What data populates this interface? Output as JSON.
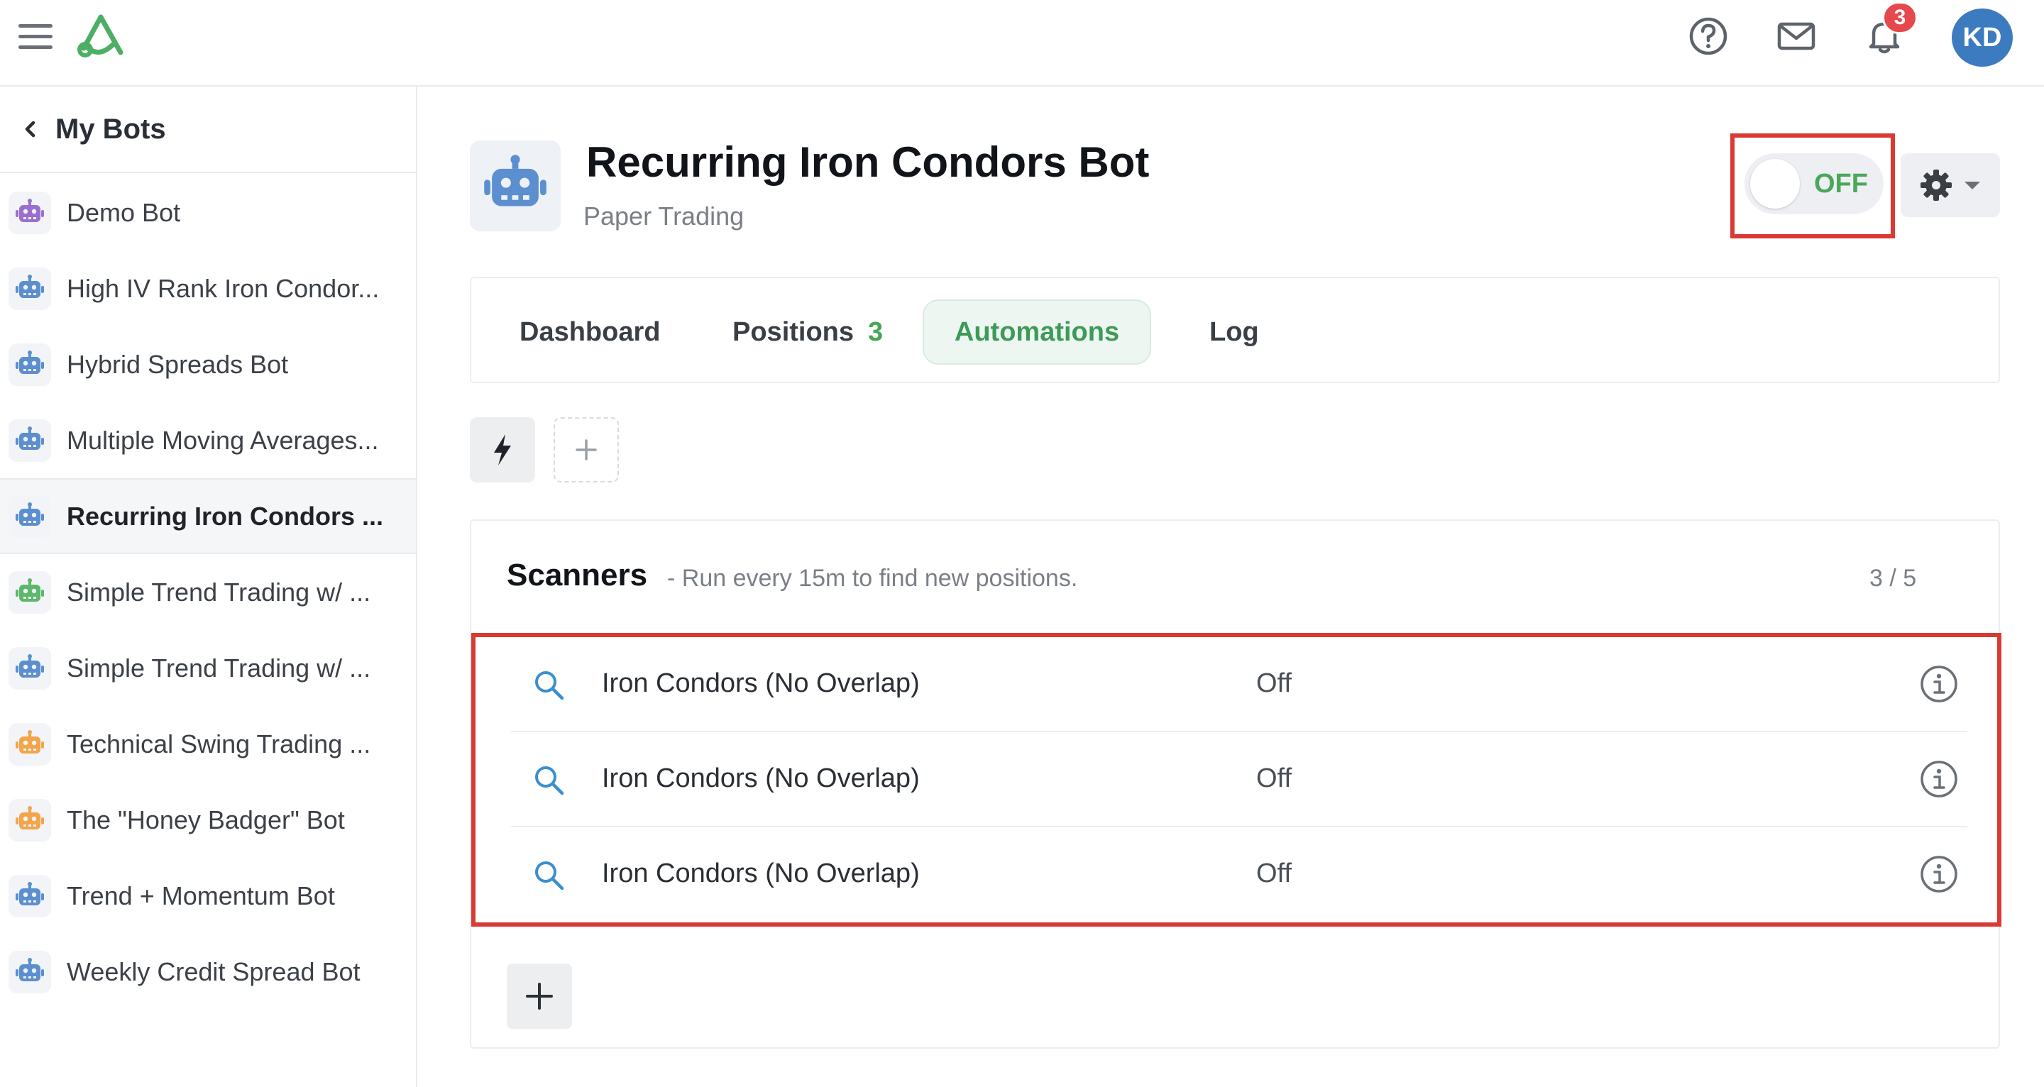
{
  "topbar": {
    "notification_count": "3",
    "avatar_initials": "KD",
    "icons": [
      "menu-icon",
      "logo",
      "help-icon",
      "mail-icon",
      "bell-icon"
    ]
  },
  "sidebar": {
    "back_label": "My Bots",
    "bots": [
      {
        "name": "Demo Bot",
        "color": "#9b6fd0"
      },
      {
        "name": "High IV Rank Iron Condor...",
        "color": "#5b8fd0"
      },
      {
        "name": "Hybrid Spreads Bot",
        "color": "#5b8fd0"
      },
      {
        "name": "Multiple Moving Averages...",
        "color": "#5b8fd0"
      },
      {
        "name": "Recurring Iron Condors ...",
        "color": "#5b8fd0",
        "active": true
      },
      {
        "name": "Simple Trend Trading w/ ...",
        "color": "#5cb86a"
      },
      {
        "name": "Simple Trend Trading w/ ...",
        "color": "#5b8fd0"
      },
      {
        "name": "Technical Swing Trading ...",
        "color": "#f2a54a"
      },
      {
        "name": "The \"Honey Badger\" Bot",
        "color": "#f2a54a"
      },
      {
        "name": "Trend + Momentum Bot",
        "color": "#5b8fd0"
      },
      {
        "name": "Weekly Credit Spread Bot",
        "color": "#5b8fd0"
      }
    ]
  },
  "bot": {
    "title": "Recurring Iron Condors Bot",
    "subtitle": "Paper Trading",
    "toggle_label": "OFF",
    "toggle_on": false
  },
  "tabs": [
    {
      "label": "Dashboard"
    },
    {
      "label": "Positions",
      "count": "3"
    },
    {
      "label": "Automations",
      "active": true
    },
    {
      "label": "Log"
    }
  ],
  "scanners": {
    "title": "Scanners",
    "description": "- Run every 15m to find new positions.",
    "count": "3 / 5",
    "rows": [
      {
        "name": "Iron Condors (No Overlap)",
        "status": "Off"
      },
      {
        "name": "Iron Condors (No Overlap)",
        "status": "Off"
      },
      {
        "name": "Iron Condors (No Overlap)",
        "status": "Off"
      }
    ]
  },
  "colors": {
    "accent_green": "#47a758",
    "highlight_red": "#d93a34",
    "avatar_blue": "#3c7bbf",
    "badge_red": "#e5484d"
  }
}
